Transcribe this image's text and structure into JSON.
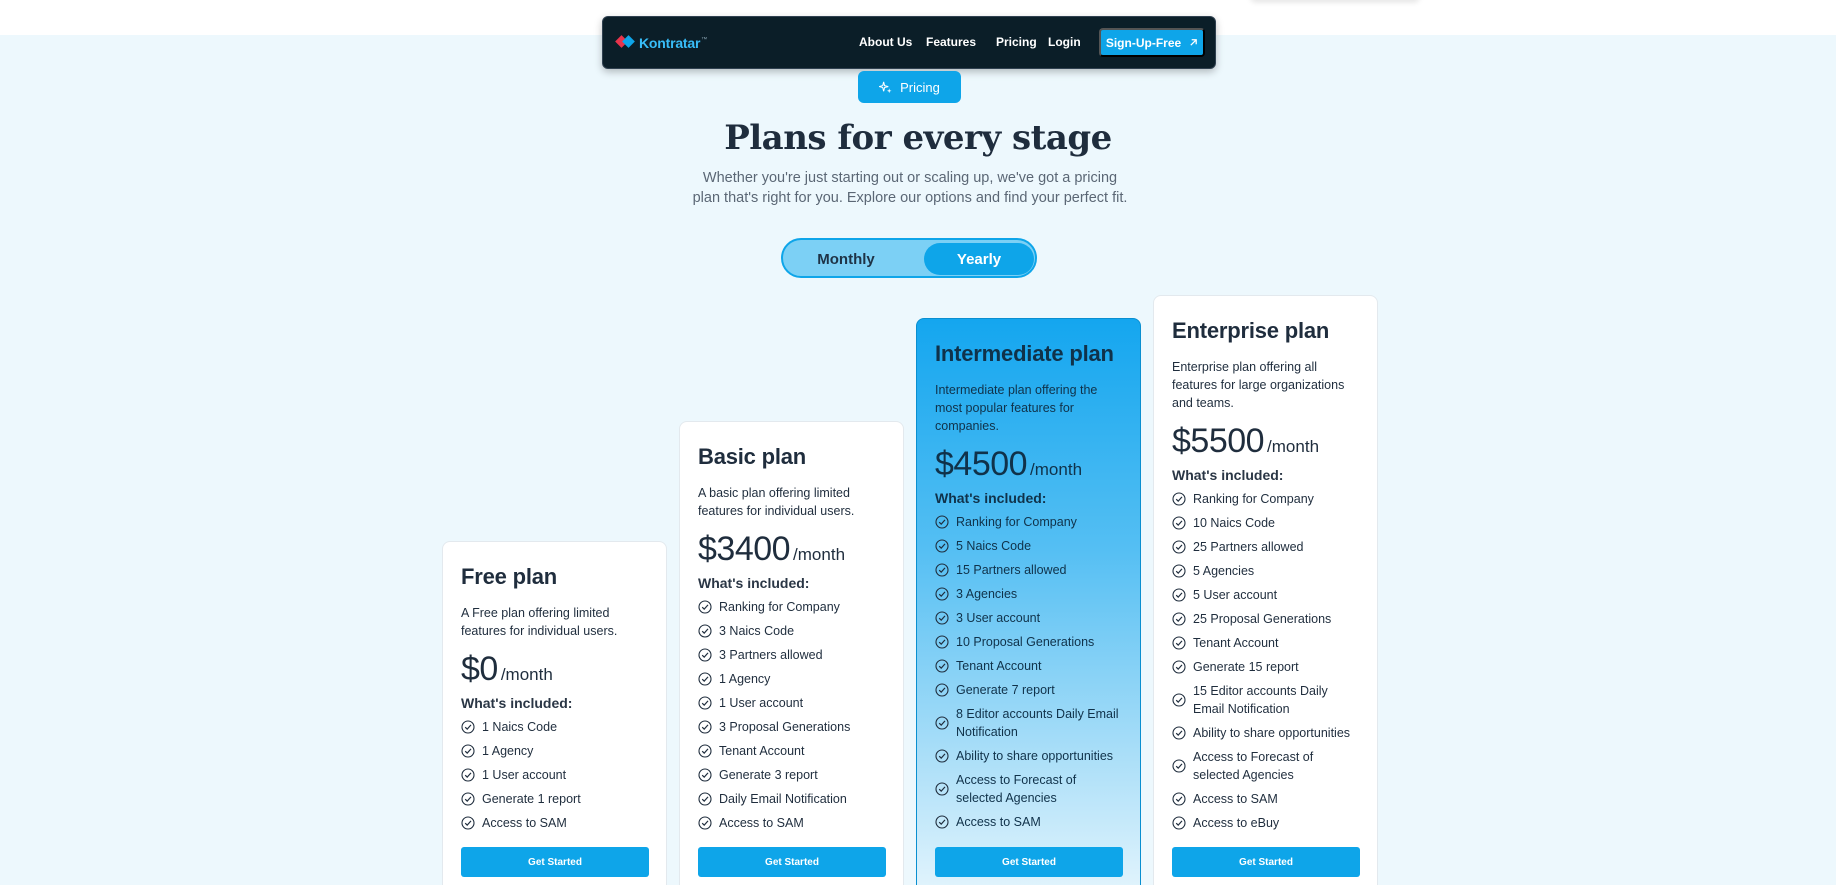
{
  "nav": {
    "logo": "Kontratar",
    "logo_tm": "™",
    "links": [
      "About Us",
      "Features",
      "Pricing",
      "Login"
    ],
    "signup": "Sign-Up-Free",
    "signup_icon": "arrow-up-right-icon"
  },
  "hero": {
    "pill": "Pricing",
    "pill_icon": "sparkle-icon",
    "title": "Plans for every stage",
    "subtitle": "Whether you're just starting out or scaling up, we've got a pricing plan that's right for you. Explore our options and find your perfect fit."
  },
  "billing_toggle": {
    "monthly": "Monthly",
    "yearly": "Yearly",
    "selected": "Yearly"
  },
  "colors": {
    "accent": "#0ea5e9",
    "nav_bg": "#0b1e28",
    "page_bg": "#edf8fd"
  },
  "plans": [
    {
      "name": "Free plan",
      "description": "A Free plan offering limited features for individual users.",
      "price": "$0",
      "period": "/month",
      "included_label": "What's included:",
      "features": [
        "1 Naics Code",
        "1 Agency",
        "1 User account",
        "Generate 1 report",
        "Access to SAM"
      ],
      "cta": "Get Started"
    },
    {
      "name": "Basic plan",
      "description": "A basic plan offering limited features for individual users.",
      "price": "$3400",
      "period": "/month",
      "included_label": "What's included:",
      "features": [
        "Ranking for Company",
        "3 Naics Code",
        "3 Partners allowed",
        "1 Agency",
        "1 User account",
        "3 Proposal Generations",
        "Tenant Account",
        "Generate 3 report",
        "Daily Email Notification",
        "Access to SAM"
      ],
      "cta": "Get Started"
    },
    {
      "name": "Intermediate plan",
      "description": "Intermediate plan offering the most popular features for companies.",
      "price": "$4500",
      "period": "/month",
      "included_label": "What's included:",
      "features": [
        "Ranking for Company",
        "5 Naics Code",
        "15 Partners allowed",
        "3 Agencies",
        "3 User account",
        "10 Proposal Generations",
        "Tenant Account",
        "Generate 7 report",
        "8 Editor accounts Daily Email Notification",
        "Ability to share opportunities",
        "Access to Forecast of selected Agencies",
        "Access to SAM"
      ],
      "cta": "Get Started"
    },
    {
      "name": "Enterprise plan",
      "description": "Enterprise plan offering all features for large organizations and teams.",
      "price": "$5500",
      "period": "/month",
      "included_label": "What's included:",
      "features": [
        "Ranking for Company",
        "10 Naics Code",
        "25 Partners allowed",
        "5 Agencies",
        "5 User account",
        "25 Proposal Generations",
        "Tenant Account",
        "Generate 15 report",
        "15 Editor accounts Daily Email Notification",
        "Ability to share opportunities",
        "Access to Forecast of selected Agencies",
        "Access to SAM",
        "Access to eBuy"
      ],
      "cta": "Get Started"
    }
  ]
}
